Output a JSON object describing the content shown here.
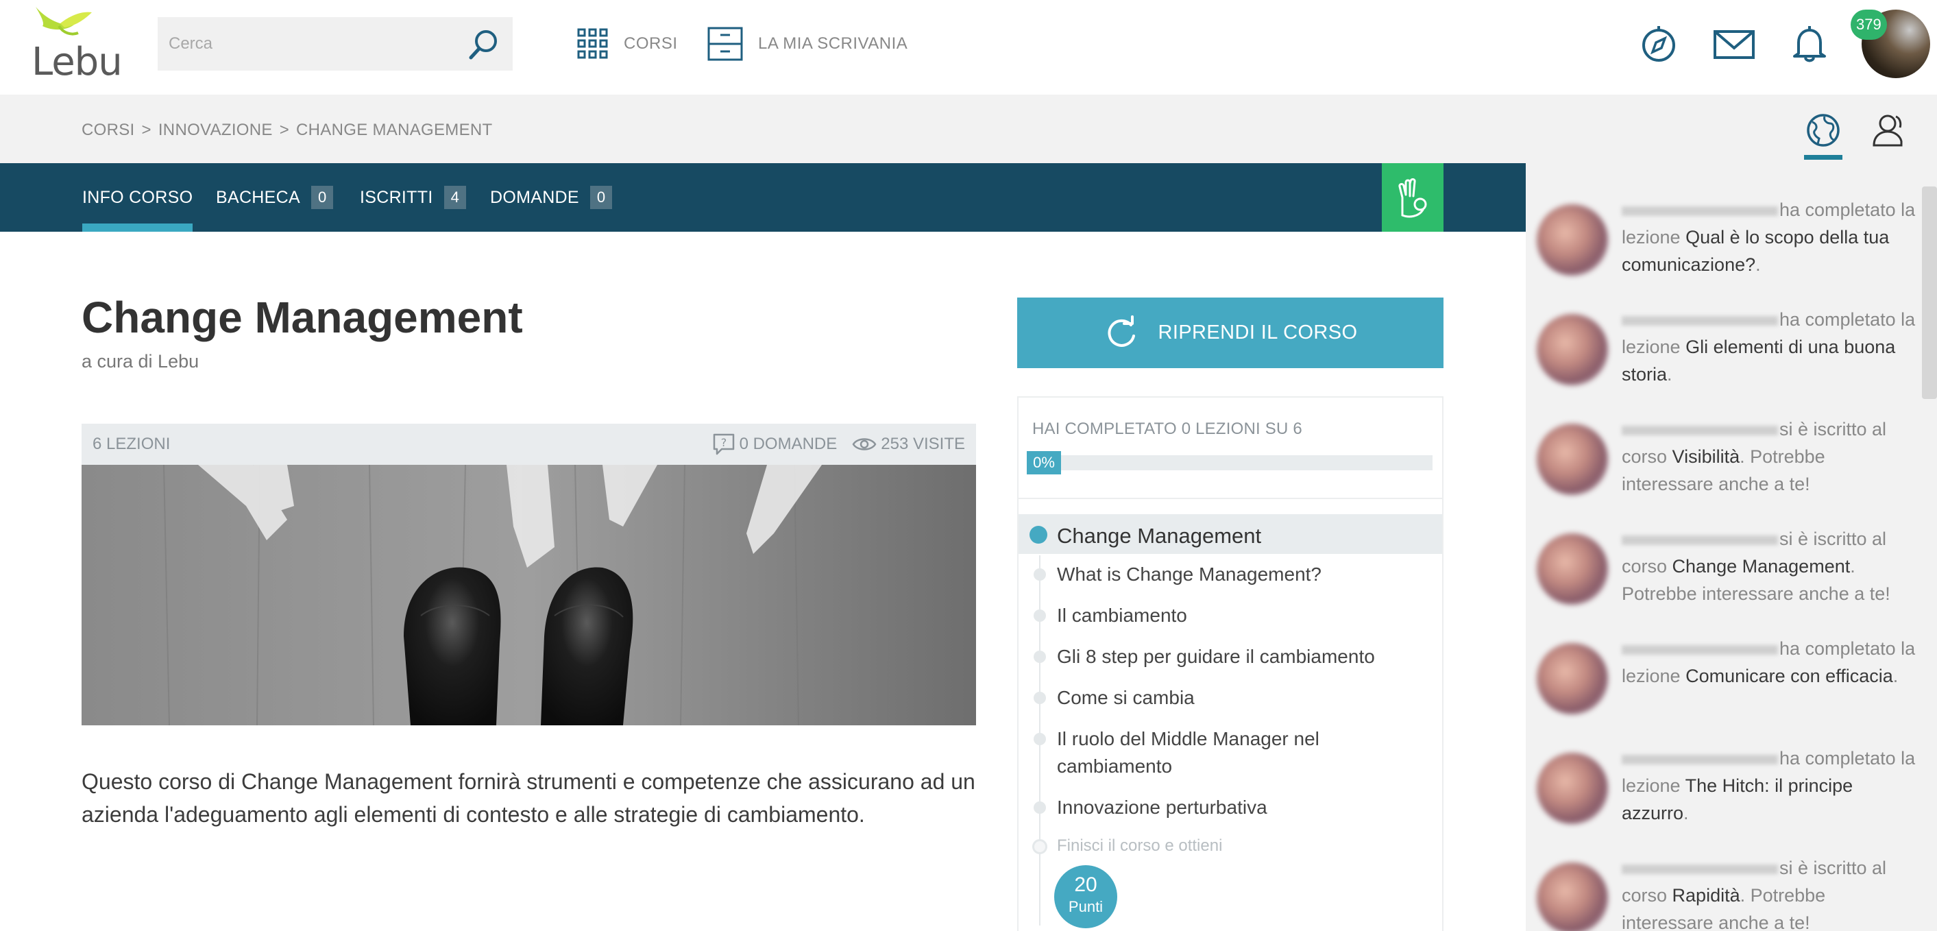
{
  "header": {
    "logo_text": "Lebu",
    "search_placeholder": "Cerca",
    "nav_courses": "CORSI",
    "nav_desk": "LA MIA SCRIVANIA",
    "notifications_count": "379"
  },
  "breadcrumb": {
    "items": [
      "CORSI",
      "INNOVAZIONE",
      "CHANGE MANAGEMENT"
    ],
    "separator": ">"
  },
  "tabs": [
    {
      "label": "INFO CORSO",
      "count": null,
      "active": true
    },
    {
      "label": "BACHECA",
      "count": "0"
    },
    {
      "label": "ISCRITTI",
      "count": "4"
    },
    {
      "label": "DOMANDE",
      "count": "0"
    }
  ],
  "course": {
    "title": "Change Management",
    "author": "a cura di Lebu",
    "lessons_count": "6 LEZIONI",
    "questions": "0 DOMANDE",
    "visits": "253 VISITE",
    "description": "Questo corso di Change Management fornirà strumenti e competenze che assicurano ad un azienda l'adeguamento agli elementi di contesto e alle strategie di cambiamento."
  },
  "panel": {
    "resume_label": "RIPRENDI IL CORSO",
    "progress_label": "HAI COMPLETATO 0 LEZIONI SU 6",
    "progress_percent": "0%",
    "progress_fraction": 0,
    "section_title": "Change Management",
    "lessons": [
      "What is Change Management?",
      "Il cambiamento",
      "Gli 8 step per guidare il cambiamento",
      "Come si cambia",
      "Il ruolo del Middle Manager nel cambiamento",
      "Innovazione perturbativa"
    ],
    "finish_label": "Finisci il corso e ottieni",
    "points_value": "20",
    "points_label": "Punti"
  },
  "feed": [
    {
      "action": "ha completato la lezione",
      "target": "Qual è lo scopo della tua comunicazione?",
      "suffix": "."
    },
    {
      "action": "ha completato la lezione",
      "target": "Gli elementi di una buona storia",
      "suffix": "."
    },
    {
      "action": "si è iscritto al corso",
      "target": "Visibilità",
      "suffix": ". Potrebbe interessare anche a te!"
    },
    {
      "action": "si è iscritto al corso",
      "target": "Change Management",
      "suffix": ". Potrebbe interessare anche a te!"
    },
    {
      "action": "ha completato la lezione",
      "target": "Comunicare con efficacia",
      "suffix": "."
    },
    {
      "action": "ha completato la lezione",
      "target": "The Hitch: il principe azzurro",
      "suffix": "."
    },
    {
      "action": "si è iscritto al corso",
      "target": "Rapidità",
      "suffix": ". Potrebbe interessare anche a te!"
    }
  ],
  "colors": {
    "tabbar": "#174a62",
    "accent": "#45a9c2",
    "green": "#2ebc6b",
    "icon_blue": "#1f5f80"
  },
  "icons": {
    "search": "search-icon",
    "courses": "grid-icon",
    "desk": "drawer-icon",
    "explore": "compass-icon",
    "mail": "mail-icon",
    "bell": "bell-icon",
    "globe": "globe-icon",
    "people": "person-icon",
    "gesture": "ok-hand-icon",
    "resume": "refresh-icon",
    "question": "question-bubble-icon",
    "eye": "eye-icon"
  }
}
